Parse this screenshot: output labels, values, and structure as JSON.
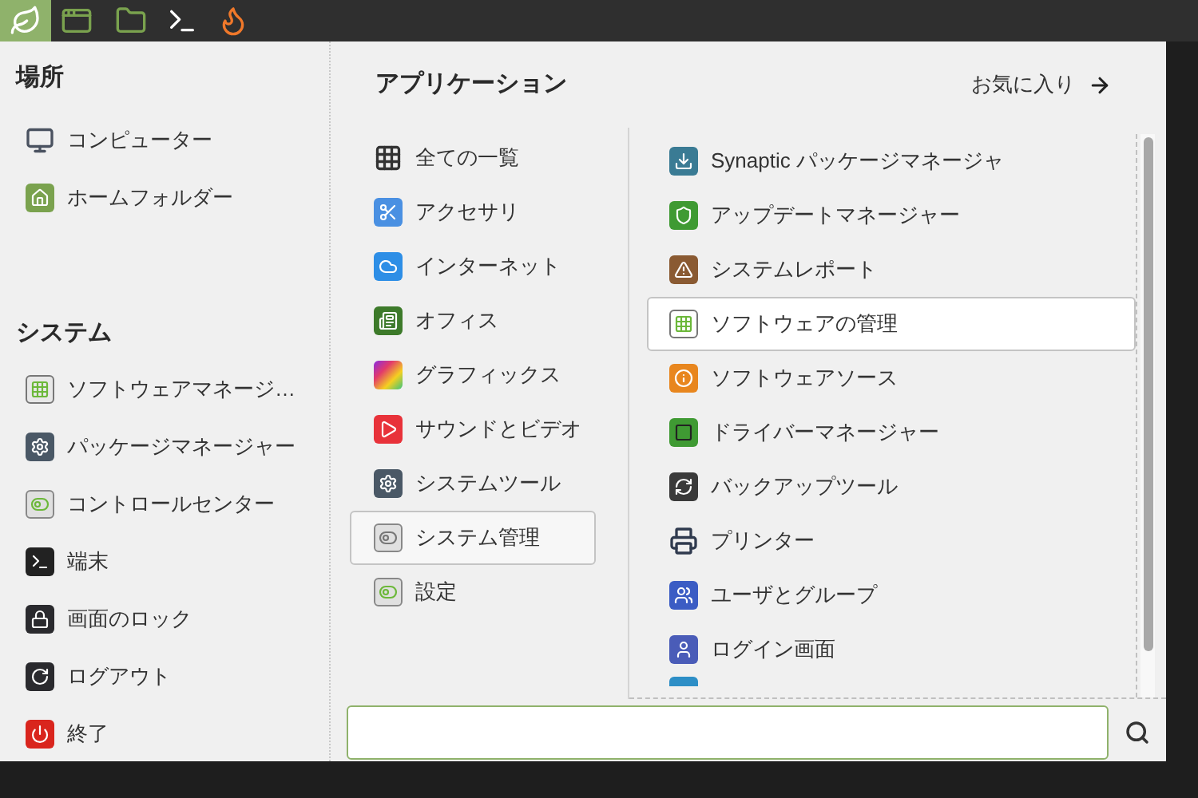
{
  "taskbar": {
    "items": [
      {
        "selected": true
      },
      {
        "selected": false
      },
      {
        "selected": false
      },
      {
        "selected": false
      },
      {
        "selected": false
      }
    ]
  },
  "places": {
    "title": "場所",
    "items": [
      {
        "label": "コンピューター"
      },
      {
        "label": "ホームフォルダー"
      }
    ]
  },
  "system": {
    "title": "システム",
    "items": [
      {
        "label": "ソフトウェアマネージ…"
      },
      {
        "label": "パッケージマネージャー"
      },
      {
        "label": "コントロールセンター"
      },
      {
        "label": "端末"
      },
      {
        "label": "画面のロック"
      },
      {
        "label": "ログアウト"
      },
      {
        "label": "終了"
      }
    ]
  },
  "applications": {
    "title": "アプリケーション",
    "favorites_link": "お気に入り"
  },
  "categories": [
    {
      "label": "全ての一覧",
      "selected": false
    },
    {
      "label": "アクセサリ",
      "selected": false
    },
    {
      "label": "インターネット",
      "selected": false
    },
    {
      "label": "オフィス",
      "selected": false
    },
    {
      "label": "グラフィックス",
      "selected": false
    },
    {
      "label": "サウンドとビデオ",
      "selected": false
    },
    {
      "label": "システムツール",
      "selected": false
    },
    {
      "label": "システム管理",
      "selected": true
    },
    {
      "label": "設定",
      "selected": false
    }
  ],
  "apps": [
    {
      "label": "Synaptic パッケージマネージャ",
      "selected": false
    },
    {
      "label": "アップデートマネージャー",
      "selected": false
    },
    {
      "label": "システムレポート",
      "selected": false
    },
    {
      "label": "ソフトウェアの管理",
      "selected": true
    },
    {
      "label": "ソフトウェアソース",
      "selected": false
    },
    {
      "label": "ドライバーマネージャー",
      "selected": false
    },
    {
      "label": "バックアップツール",
      "selected": false
    },
    {
      "label": "プリンター",
      "selected": false
    },
    {
      "label": "ユーザとグループ",
      "selected": false
    },
    {
      "label": "ログイン画面",
      "selected": false
    }
  ]
}
